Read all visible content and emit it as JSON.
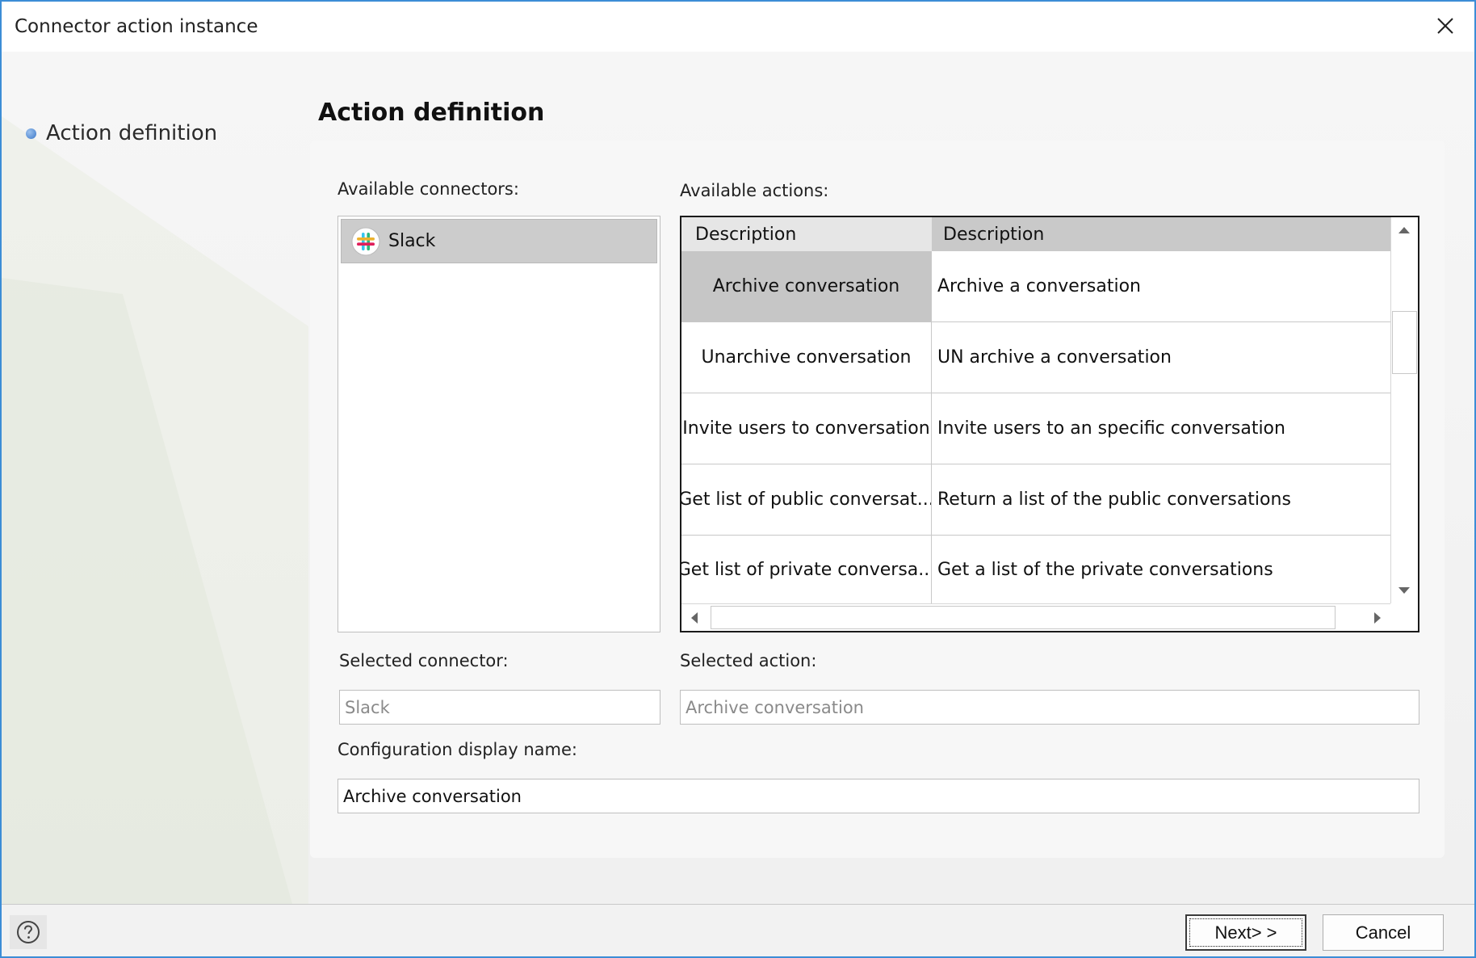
{
  "window": {
    "title": "Connector action instance"
  },
  "sidebar": {
    "steps": [
      {
        "label": "Action definition",
        "active": true
      }
    ]
  },
  "page": {
    "title": "Action definition"
  },
  "connectors": {
    "label": "Available connectors:",
    "items": [
      {
        "label": "Slack",
        "icon": "slack-logo-icon",
        "selected": true
      }
    ]
  },
  "actions": {
    "label": "Available actions:",
    "columns": [
      "Description",
      "Description"
    ],
    "rows": [
      {
        "name": "Archive conversation",
        "description": "Archive a conversation",
        "selected": true
      },
      {
        "name": "Unarchive conversation",
        "description": "UN archive a conversation"
      },
      {
        "name": "Invite users to conversation",
        "description": "Invite users to an specific conversation"
      },
      {
        "name": "Get list of public conversat...",
        "description": "Return a list of the public conversations"
      },
      {
        "name": "Get list of private conversa...",
        "description": "Get a list of the private conversations"
      }
    ]
  },
  "selected_connector": {
    "label": "Selected connector:",
    "value": "Slack"
  },
  "selected_action": {
    "label": "Selected action:",
    "value": "Archive conversation"
  },
  "config": {
    "label": "Configuration display name:",
    "value": "Archive conversation"
  },
  "footer": {
    "next_label": "Next> >",
    "cancel_label": "Cancel",
    "help_icon": "help-circle-icon"
  },
  "colors": {
    "window_border": "#3c8dd6",
    "selection": "#cccccc",
    "step_dot": "#3d78c9"
  }
}
